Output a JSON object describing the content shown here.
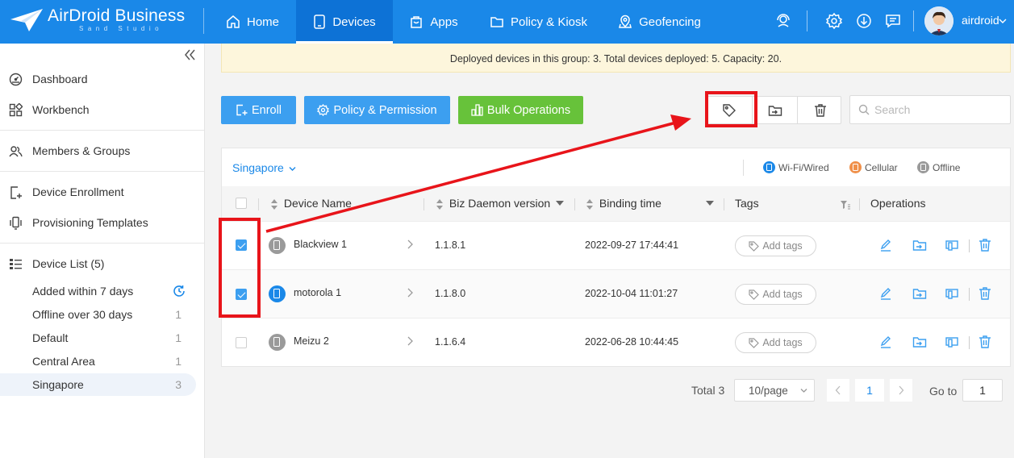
{
  "header": {
    "brand": "AirDroid Business",
    "brand_sub": "Sand Studio",
    "nav": [
      {
        "label": "Home",
        "icon": "home-icon"
      },
      {
        "label": "Devices",
        "icon": "devices-icon",
        "active": true
      },
      {
        "label": "Apps",
        "icon": "apps-icon"
      },
      {
        "label": "Policy & Kiosk",
        "icon": "folder-icon"
      },
      {
        "label": "Geofencing",
        "icon": "geofence-icon"
      }
    ],
    "username": "airdroid",
    "colors": {
      "bar": "#1a88e8",
      "active": "#0d72d6"
    }
  },
  "sidebar": {
    "items": [
      {
        "label": "Dashboard",
        "icon": "dashboard-icon"
      },
      {
        "label": "Workbench",
        "icon": "workbench-icon"
      },
      {
        "label": "Members & Groups",
        "icon": "members-icon"
      },
      {
        "label": "Device Enrollment",
        "icon": "enrollment-icon"
      },
      {
        "label": "Provisioning Templates",
        "icon": "templates-icon"
      },
      {
        "label": "Device List (5)",
        "icon": "list-icon"
      }
    ],
    "groups": [
      {
        "label": "Added within 7 days",
        "count": ""
      },
      {
        "label": "Offline over 30 days",
        "count": "1"
      },
      {
        "label": "Default",
        "count": "1"
      },
      {
        "label": "Central Area",
        "count": "1"
      },
      {
        "label": "Singapore",
        "count": "3",
        "active": true
      }
    ]
  },
  "banner": "Deployed devices in this group: 3. Total devices deployed: 5. Capacity: 20.",
  "toolbar": {
    "enroll": "Enroll",
    "policy": "Policy & Permission",
    "bulk": "Bulk Operations",
    "search_placeholder": "Search"
  },
  "table": {
    "group": "Singapore",
    "legend": [
      {
        "label": "Wi-Fi/Wired",
        "color": "#1a88e8"
      },
      {
        "label": "Cellular",
        "color": "#f0904a"
      },
      {
        "label": "Offline",
        "color": "#9a9a9a"
      }
    ],
    "headers": {
      "name": "Device Name",
      "daemon": "Biz Daemon version",
      "binding": "Binding time",
      "tags": "Tags",
      "ops": "Operations"
    },
    "rows": [
      {
        "name": "Blackview 1",
        "version": "1.1.8.1",
        "time": "2022-09-27 17:44:41",
        "tag": "Add tags",
        "checked": true,
        "status": "#9a9a9a"
      },
      {
        "name": "motorola 1",
        "version": "1.1.8.0",
        "time": "2022-10-04 11:01:27",
        "tag": "Add tags",
        "checked": true,
        "status": "#1a88e8"
      },
      {
        "name": "Meizu 2",
        "version": "1.1.6.4",
        "time": "2022-06-28 10:44:45",
        "tag": "Add tags",
        "checked": false,
        "status": "#9a9a9a"
      }
    ]
  },
  "pagination": {
    "total": "Total 3",
    "per_page": "10/page",
    "current": "1",
    "goto_label": "Go to",
    "goto_value": "1"
  }
}
